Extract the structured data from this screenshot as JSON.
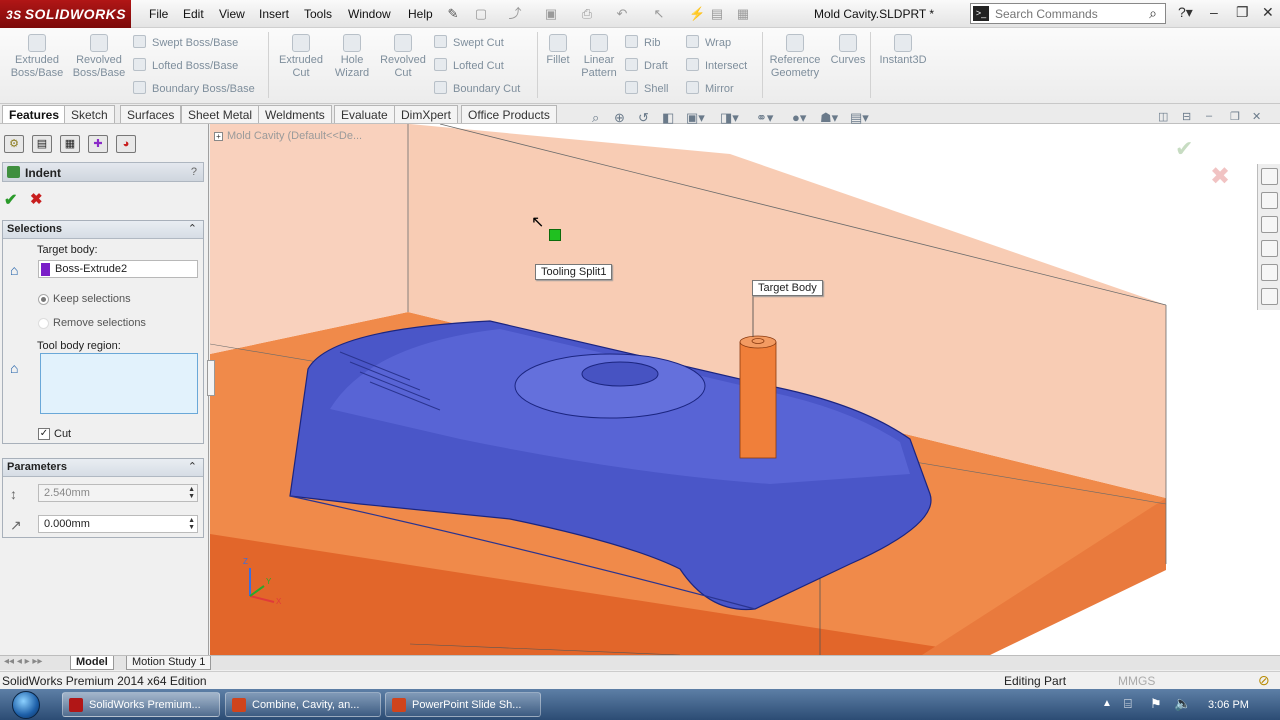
{
  "app": {
    "brand": "SOLIDWORKS",
    "brand_prefix": "3S",
    "document_title": "Mold Cavity.SLDPRT *"
  },
  "menu": [
    "File",
    "Edit",
    "View",
    "Insert",
    "Tools",
    "Window",
    "Help"
  ],
  "search": {
    "placeholder": "Search Commands"
  },
  "commands": {
    "extruded_boss": "Extruded Boss/Base",
    "revolved_boss": "Revolved Boss/Base",
    "swept_boss": "Swept Boss/Base",
    "lofted_boss": "Lofted Boss/Base",
    "boundary_boss": "Boundary Boss/Base",
    "extruded_cut": "Extruded Cut",
    "hole_wizard": "Hole Wizard",
    "revolved_cut": "Revolved Cut",
    "swept_cut": "Swept Cut",
    "lofted_cut": "Lofted Cut",
    "boundary_cut": "Boundary Cut",
    "fillet": "Fillet",
    "linear_pattern": "Linear Pattern",
    "rib": "Rib",
    "draft": "Draft",
    "shell": "Shell",
    "wrap": "Wrap",
    "intersect": "Intersect",
    "mirror": "Mirror",
    "reference_geometry": "Reference Geometry",
    "curves": "Curves",
    "instant3d": "Instant3D"
  },
  "tabs": [
    "Features",
    "Sketch",
    "Surfaces",
    "Sheet Metal",
    "Weldments",
    "Evaluate",
    "DimXpert",
    "Office Products"
  ],
  "property_manager": {
    "title": "Indent",
    "selections": {
      "header": "Selections",
      "target_body_label": "Target body:",
      "target_body_value": "Boss-Extrude2",
      "keep_selections": "Keep selections",
      "remove_selections": "Remove selections",
      "tool_body_region_label": "Tool body region:",
      "cut_label": "Cut",
      "cut_checked": true
    },
    "parameters": {
      "header": "Parameters",
      "thickness": "2.540mm",
      "clearance": "0.000mm"
    }
  },
  "viewport": {
    "tree_label": "Mold Cavity  (Default<<De...",
    "callout_tooling": "Tooling Split1",
    "callout_target": "Target Body",
    "triad": {
      "x": "X",
      "y": "Y",
      "z": "Z"
    }
  },
  "bottom_tabs": [
    "Model",
    "Motion Study 1"
  ],
  "status": {
    "edition": "SolidWorks Premium 2014 x64 Edition",
    "mode": "Editing Part",
    "units": "MMGS"
  },
  "taskbar": {
    "items": [
      "SolidWorks Premium...",
      "Combine, Cavity, an...",
      "PowerPoint Slide Sh..."
    ],
    "clock": "3:06 PM"
  },
  "colors": {
    "mold_block": "#f08a4a",
    "mold_block_dark": "#e2662a",
    "cavity_box": "#f8c9b0",
    "part": "#4a56c8",
    "pin": "#f07f3a",
    "brand_red": "#9f1010"
  }
}
